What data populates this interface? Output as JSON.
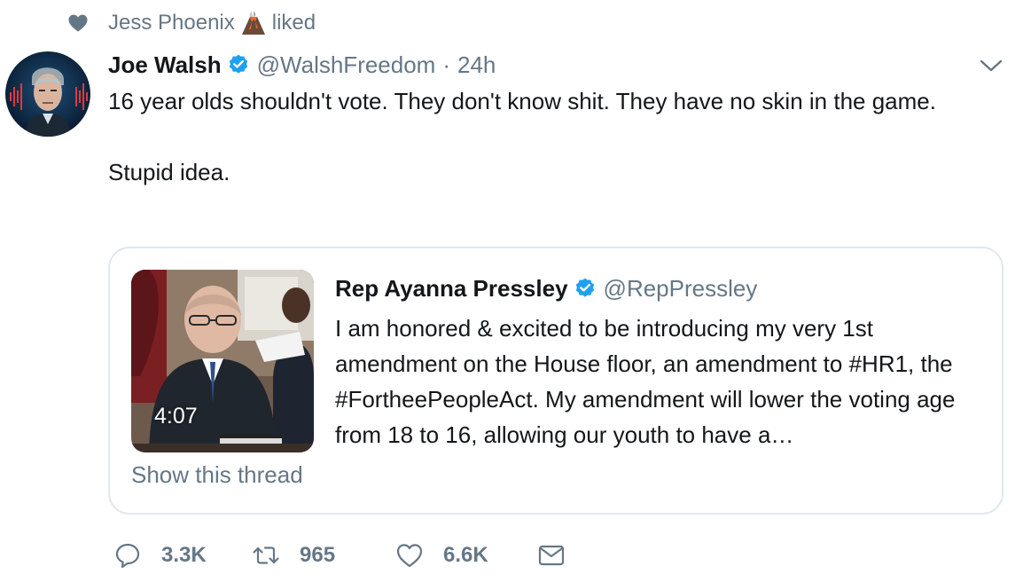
{
  "social_context": {
    "liker_name": "Jess Phoenix",
    "action": "liked"
  },
  "tweet": {
    "author_name": "Joe Walsh",
    "handle": "@WalshFreedom",
    "separator": "·",
    "time": "24h",
    "text_line_1": "16 year olds shouldn't vote. They don't know shit. They have no skin in the game.",
    "text_line_2": "Stupid idea."
  },
  "quoted_tweet": {
    "author_name": "Rep Ayanna Pressley",
    "handle": "@RepPressley",
    "text": "I am honored & excited to be introducing my very 1st amendment on the House floor, an amendment to #HR1, the #FortheePeopleAct. My amendment will lower the voting age from 18 to 16, allowing our youth to have a…",
    "video_duration": "4:07",
    "show_thread_label": "Show this thread"
  },
  "actions": {
    "reply_count": "3.3K",
    "retweet_count": "965",
    "like_count": "6.6K"
  },
  "colors": {
    "verified_blue": "#1da1f2",
    "secondary_text": "#657786",
    "primary_text": "#14171a",
    "border": "#e1e8ed"
  },
  "icons": [
    "heart-icon",
    "volcano-emoji-icon",
    "verified-badge-icon",
    "chevron-down-icon",
    "reply-icon",
    "retweet-icon",
    "like-icon",
    "direct-message-icon"
  ]
}
